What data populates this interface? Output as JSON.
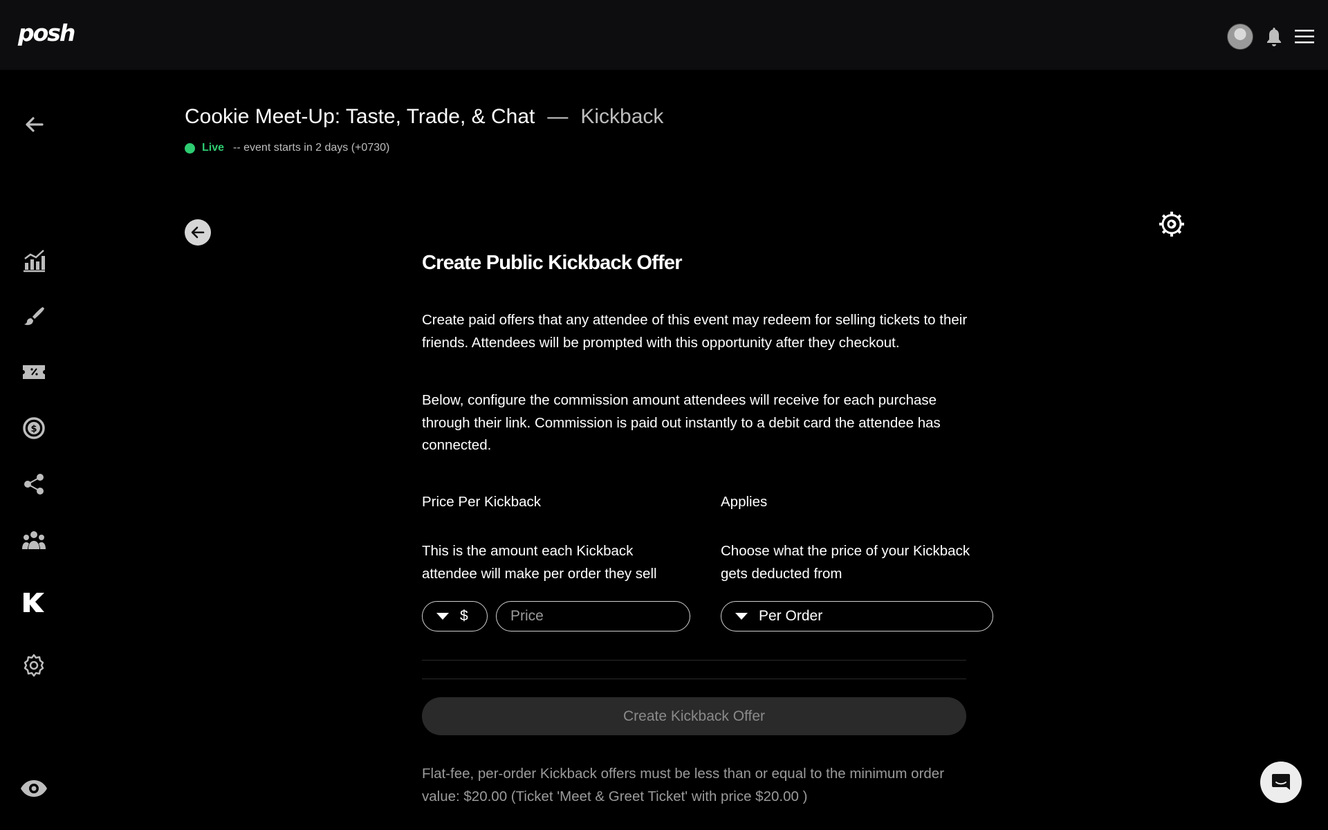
{
  "app": {
    "logo": "posh"
  },
  "topbar": {
    "icons": [
      "avatar",
      "bell-icon",
      "hamburger-menu-icon"
    ]
  },
  "sidebar": {
    "items": [
      {
        "name": "back-arrow-icon"
      },
      {
        "name": "analytics-chart-icon"
      },
      {
        "name": "paintbrush-icon"
      },
      {
        "name": "ticket-icon"
      },
      {
        "name": "finance-dollar-icon"
      },
      {
        "name": "referral-network-icon"
      },
      {
        "name": "team-people-icon"
      },
      {
        "name": "kickback-k-icon",
        "active": true
      },
      {
        "name": "settings-gear-icon"
      },
      {
        "name": "preview-eye-icon"
      }
    ]
  },
  "header": {
    "event_title": "Cookie Meet-Up: Taste, Trade, & Chat",
    "separator": "—",
    "section": "Kickback",
    "status": "Live",
    "status_detail": "-- event starts in 2 days (+0730)"
  },
  "form": {
    "title": "Create Public Kickback Offer",
    "intro": "Create paid offers that any attendee of this event may redeem for selling tickets to their friends. Attendees will be prompted with this opportunity after they checkout.",
    "instructions": "Below, configure the commission amount attendees will receive for each purchase through their link. Commission is paid out instantly to a debit card the attendee has connected.",
    "price_label": "Price Per Kickback",
    "price_desc": "This is the amount each Kickback attendee will make per order they sell",
    "currency": "$",
    "price_placeholder": "Price",
    "applies_label": "Applies",
    "applies_desc": "Choose what the price of your Kickback gets deducted from",
    "applies_value": "Per Order",
    "submit_label": "Create Kickback Offer",
    "note": "Flat-fee, per-order Kickback offers must be less than or equal to the minimum order value: $20.00 (Ticket 'Meet & Greet Ticket' with price $20.00 )"
  },
  "colors": {
    "accent_live": "#2ecc71",
    "background": "#000000",
    "topbar": "#0d0d0f"
  }
}
